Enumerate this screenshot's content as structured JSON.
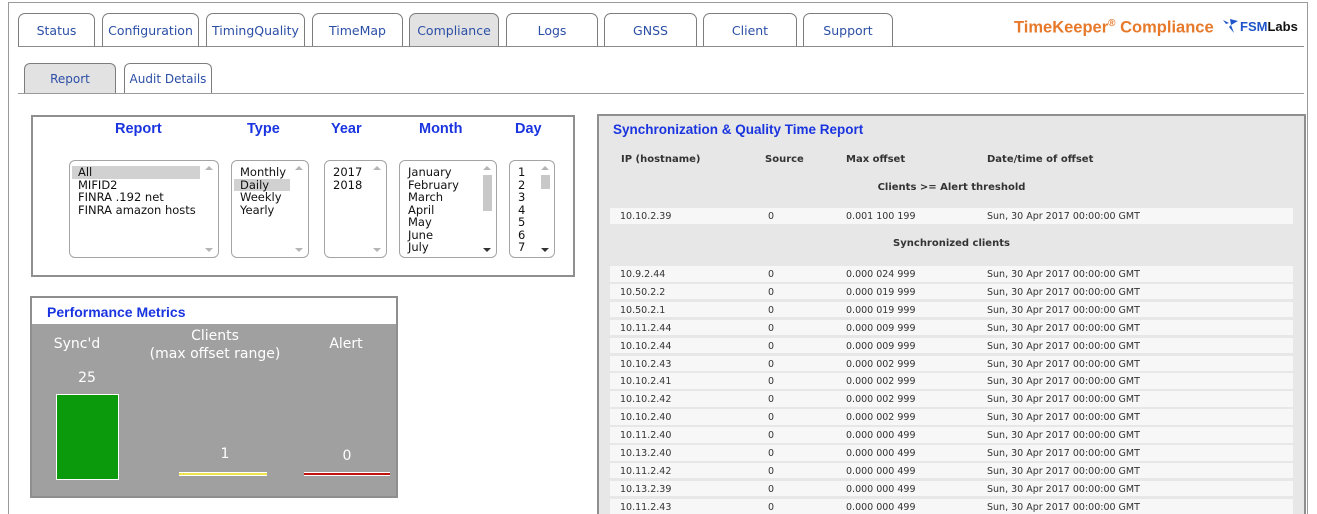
{
  "tabs": [
    "Status",
    "Configuration",
    "TimingQuality",
    "TimeMap",
    "Compliance",
    "Logs",
    "GNSS",
    "Client",
    "Support"
  ],
  "active_tab": "Compliance",
  "brand": {
    "name": "TimeKeeper",
    "reg": "®",
    "suffix": " Compliance"
  },
  "logo": {
    "fsm": "FSM",
    "labs": "Labs"
  },
  "subtabs": [
    "Report",
    "Audit Details"
  ],
  "selectors": {
    "headers": {
      "report": "Report",
      "type": "Type",
      "year": "Year",
      "month": "Month",
      "day": "Day"
    },
    "report_options": [
      "All",
      "MIFID2",
      "FINRA .192 net",
      "FINRA amazon hosts"
    ],
    "report_selected": "All",
    "type_options": [
      "Monthly",
      "Daily",
      "Weekly",
      "Yearly"
    ],
    "type_selected": "Daily",
    "year_options": [
      "2017",
      "2018"
    ],
    "month_options": [
      "January",
      "February",
      "March",
      "April",
      "May",
      "June",
      "July"
    ],
    "day_options": [
      "1",
      "2",
      "3",
      "4",
      "5",
      "6",
      "7"
    ]
  },
  "metrics": {
    "title": "Performance Metrics",
    "synced_label": "Sync'd",
    "clients_label": "Clients",
    "clients_sub": "(max offset range)",
    "alert_label": "Alert",
    "synced_value": "25",
    "clients_value": "1",
    "alert_value": "0",
    "colors": {
      "synced": "#0b9a0b",
      "clients": "#eee34c",
      "alert": "#c11010"
    }
  },
  "report": {
    "title": "Synchronization & Quality Time Report",
    "columns": [
      "IP (hostname)",
      "Source",
      "Max offset",
      "Date/time of offset"
    ],
    "alert_section": "Clients >= Alert threshold",
    "alert_rows": [
      [
        "10.10.2.39",
        "0",
        "0.001 100 199",
        "Sun, 30 Apr 2017 00:00:00 GMT"
      ]
    ],
    "sync_section": "Synchronized clients",
    "sync_rows": [
      [
        "10.9.2.44",
        "0",
        "0.000 024 999",
        "Sun, 30 Apr 2017 00:00:00 GMT"
      ],
      [
        "10.50.2.2",
        "0",
        "0.000 019 999",
        "Sun, 30 Apr 2017 00:00:00 GMT"
      ],
      [
        "10.50.2.1",
        "0",
        "0.000 019 999",
        "Sun, 30 Apr 2017 00:00:00 GMT"
      ],
      [
        "10.11.2.44",
        "0",
        "0.000 009 999",
        "Sun, 30 Apr 2017 00:00:00 GMT"
      ],
      [
        "10.10.2.44",
        "0",
        "0.000 009 999",
        "Sun, 30 Apr 2017 00:00:00 GMT"
      ],
      [
        "10.10.2.43",
        "0",
        "0.000 002 999",
        "Sun, 30 Apr 2017 00:00:00 GMT"
      ],
      [
        "10.10.2.41",
        "0",
        "0.000 002 999",
        "Sun, 30 Apr 2017 00:00:00 GMT"
      ],
      [
        "10.10.2.42",
        "0",
        "0.000 002 999",
        "Sun, 30 Apr 2017 00:00:00 GMT"
      ],
      [
        "10.10.2.40",
        "0",
        "0.000 002 999",
        "Sun, 30 Apr 2017 00:00:00 GMT"
      ],
      [
        "10.11.2.40",
        "0",
        "0.000 000 499",
        "Sun, 30 Apr 2017 00:00:00 GMT"
      ],
      [
        "10.13.2.40",
        "0",
        "0.000 000 499",
        "Sun, 30 Apr 2017 00:00:00 GMT"
      ],
      [
        "10.11.2.42",
        "0",
        "0.000 000 499",
        "Sun, 30 Apr 2017 00:00:00 GMT"
      ],
      [
        "10.13.2.39",
        "0",
        "0.000 000 499",
        "Sun, 30 Apr 2017 00:00:00 GMT"
      ],
      [
        "10.11.2.43",
        "0",
        "0.000 000 499",
        "Sun, 30 Apr 2017 00:00:00 GMT"
      ]
    ]
  }
}
